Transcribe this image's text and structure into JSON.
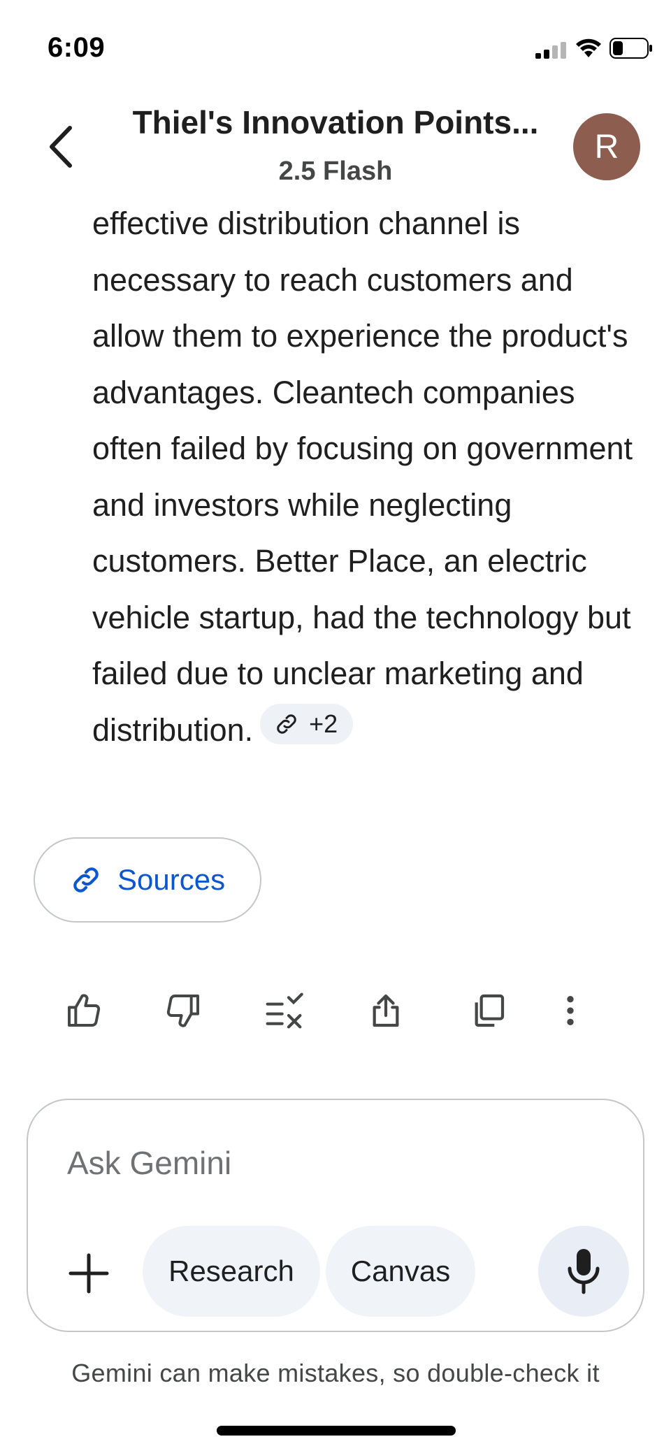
{
  "status_bar": {
    "time": "6:09"
  },
  "header": {
    "title": "Thiel's Innovation Points...",
    "model": "2.5 Flash",
    "avatar_initial": "R"
  },
  "response": {
    "text": "effective distribution channel is necessary to reach customers and allow them to experience the product's advantages. Cleantech companies often failed by focusing on government and investors while neglecting customers. Better Place, an electric vehicle startup, had the technology but failed due to unclear marketing and distribution.",
    "citation_count": "+2"
  },
  "sources": {
    "label": "Sources"
  },
  "actions": [
    "thumbs-up",
    "thumbs-down",
    "modify-response",
    "share",
    "copy",
    "more-options"
  ],
  "composer": {
    "placeholder": "Ask Gemini",
    "research_label": "Research",
    "canvas_label": "Canvas"
  },
  "disclaimer": "Gemini can make mistakes, so double-check it",
  "colors": {
    "accent_blue": "#0b57d0",
    "avatar_bg": "#8d5d4f",
    "chip_bg": "#f0f4f9"
  }
}
